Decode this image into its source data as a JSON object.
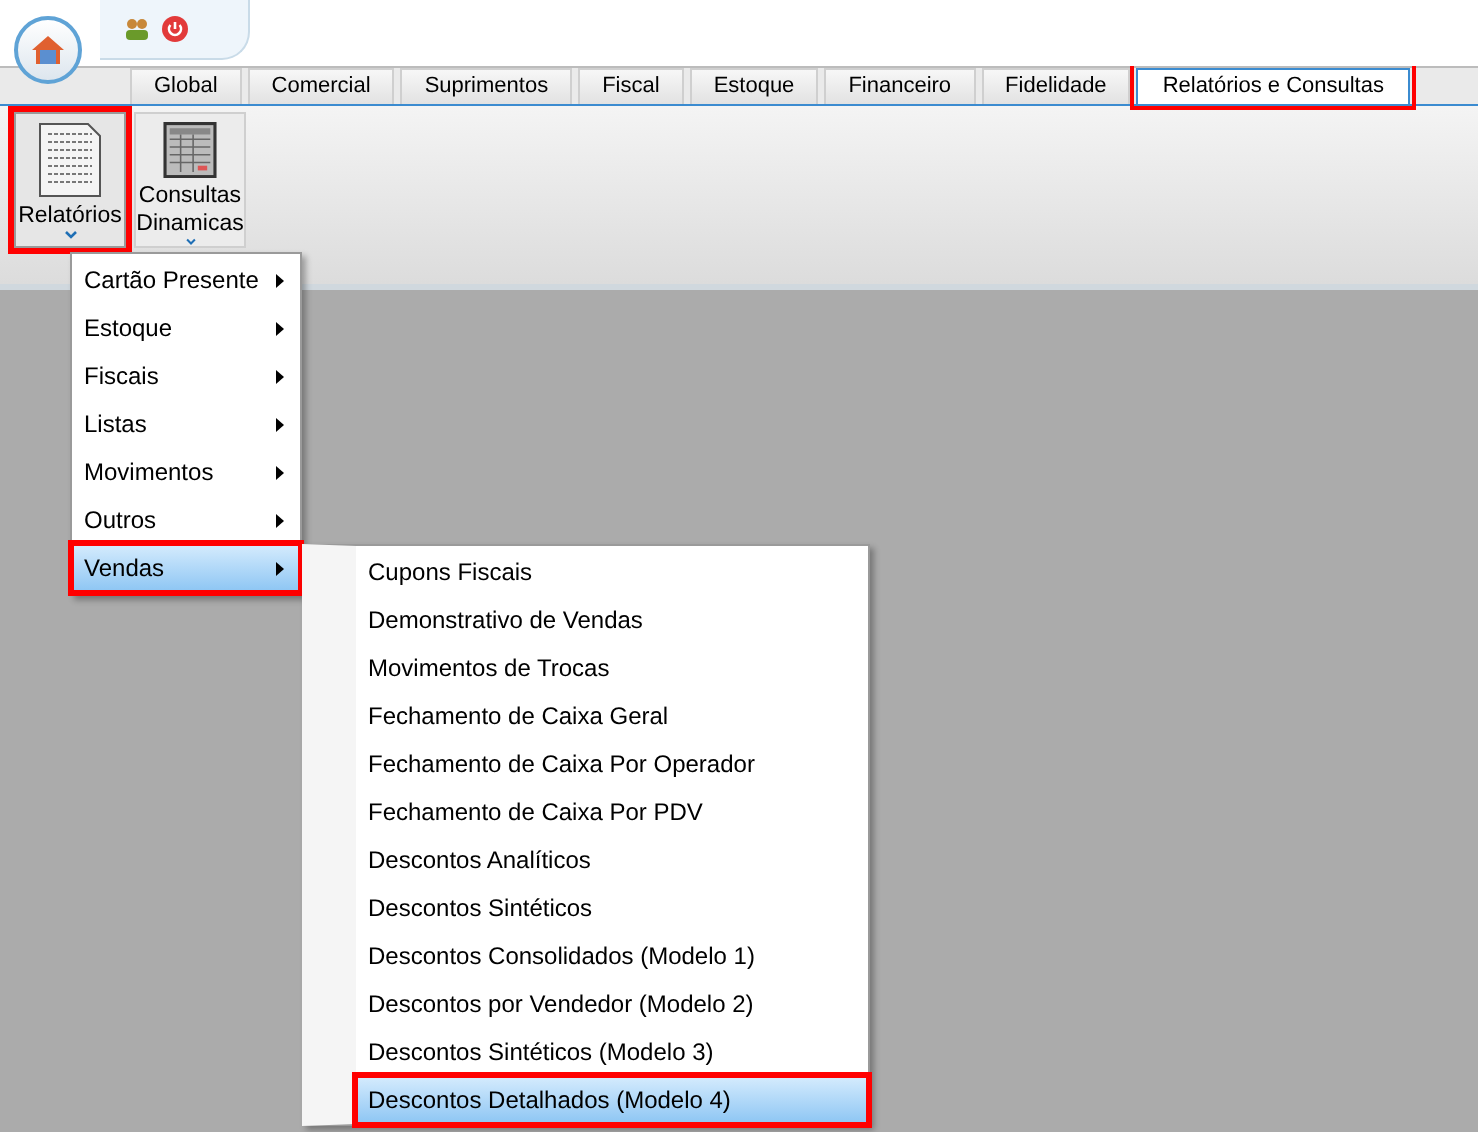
{
  "tabs": [
    {
      "label": "Global",
      "selected": false,
      "annotated": false
    },
    {
      "label": "Comercial",
      "selected": false,
      "annotated": false
    },
    {
      "label": "Suprimentos",
      "selected": false,
      "annotated": false
    },
    {
      "label": "Fiscal",
      "selected": false,
      "annotated": false
    },
    {
      "label": "Estoque",
      "selected": false,
      "annotated": false
    },
    {
      "label": "Financeiro",
      "selected": false,
      "annotated": false
    },
    {
      "label": "Fidelidade",
      "selected": false,
      "annotated": false
    },
    {
      "label": "Relatórios e Consultas",
      "selected": true,
      "annotated": true
    }
  ],
  "ribbon_buttons": [
    {
      "label": "Relatórios",
      "kind": "report",
      "annotated": true,
      "expanded": true
    },
    {
      "label": "Consultas Dinamicas",
      "kind": "grid",
      "annotated": false,
      "expanded": false
    }
  ],
  "menu": {
    "items": [
      {
        "label": "Cartão Presente",
        "selected": false,
        "annotated": false
      },
      {
        "label": "Estoque",
        "selected": false,
        "annotated": false
      },
      {
        "label": "Fiscais",
        "selected": false,
        "annotated": false
      },
      {
        "label": "Listas",
        "selected": false,
        "annotated": false
      },
      {
        "label": "Movimentos",
        "selected": false,
        "annotated": false
      },
      {
        "label": "Outros",
        "selected": false,
        "annotated": false
      },
      {
        "label": "Vendas",
        "selected": true,
        "annotated": true
      }
    ]
  },
  "submenu": {
    "items": [
      {
        "label": "Cupons Fiscais",
        "selected": false,
        "annotated": false
      },
      {
        "label": "Demonstrativo de Vendas",
        "selected": false,
        "annotated": false
      },
      {
        "label": "Movimentos de Trocas",
        "selected": false,
        "annotated": false
      },
      {
        "label": "Fechamento de Caixa Geral",
        "selected": false,
        "annotated": false
      },
      {
        "label": "Fechamento de Caixa Por Operador",
        "selected": false,
        "annotated": false
      },
      {
        "label": "Fechamento de Caixa Por PDV",
        "selected": false,
        "annotated": false
      },
      {
        "label": "Descontos Analíticos",
        "selected": false,
        "annotated": false
      },
      {
        "label": "Descontos Sintéticos",
        "selected": false,
        "annotated": false
      },
      {
        "label": "Descontos Consolidados (Modelo 1)",
        "selected": false,
        "annotated": false
      },
      {
        "label": "Descontos por Vendedor (Modelo 2)",
        "selected": false,
        "annotated": false
      },
      {
        "label": "Descontos Sintéticos (Modelo 3)",
        "selected": false,
        "annotated": false
      },
      {
        "label": "Descontos Detalhados (Modelo 4)",
        "selected": true,
        "annotated": true
      }
    ]
  }
}
